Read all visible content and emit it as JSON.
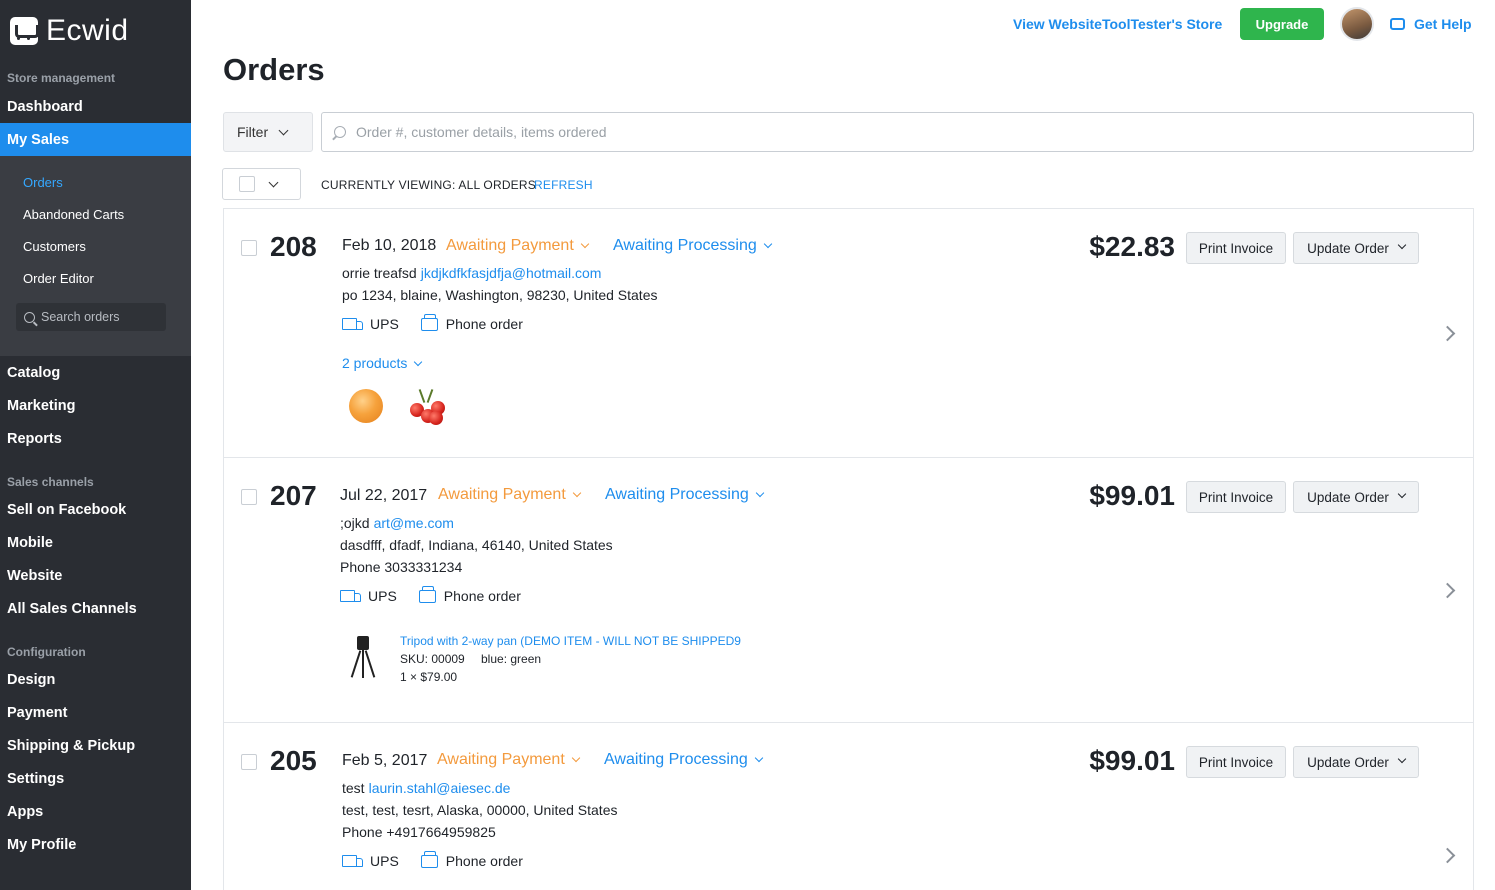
{
  "sidebar": {
    "logo_text": "Ecwid",
    "section_store": "Store management",
    "dashboard": "Dashboard",
    "my_sales": "My Sales",
    "sub_items": [
      "Orders",
      "Abandoned Carts",
      "Customers",
      "Order Editor"
    ],
    "search_placeholder": "Search orders",
    "catalog": "Catalog",
    "marketing": "Marketing",
    "reports": "Reports",
    "section_channels": "Sales channels",
    "facebook": "Sell on Facebook",
    "mobile": "Mobile",
    "website": "Website",
    "all_channels": "All Sales Channels",
    "section_config": "Configuration",
    "design": "Design",
    "payment": "Payment",
    "shipping": "Shipping & Pickup",
    "settings": "Settings",
    "apps": "Apps",
    "profile": "My Profile"
  },
  "topbar": {
    "store_link": "View WebsiteToolTester's Store",
    "upgrade": "Upgrade",
    "help": "Get Help"
  },
  "page": {
    "title": "Orders",
    "filter_label": "Filter",
    "search_placeholder": "Order #, customer details, items ordered",
    "viewing": "CURRENTLY VIEWING: ALL ORDERS",
    "refresh": "REFRESH"
  },
  "orders": [
    {
      "number": "208",
      "date": "Feb 10, 2018",
      "payment_status": "Awaiting Payment",
      "processing_status": "Awaiting Processing",
      "customer_name": "orrie treafsd",
      "email": "jkdjkdfkfasjdfja@hotmail.com",
      "address": "po 1234, blaine, Washington, 98230, United States",
      "shipping": "UPS",
      "order_type": "Phone order",
      "products_link": "2 products",
      "price": "$22.83",
      "print_invoice": "Print Invoice",
      "update_order": "Update Order"
    },
    {
      "number": "207",
      "date": "Jul 22, 2017",
      "payment_status": "Awaiting Payment",
      "processing_status": "Awaiting Processing",
      "customer_name": ";ojkd",
      "email": "art@me.com",
      "address": "dasdfff, dfadf, Indiana, 46140, United States",
      "phone": "Phone 3033331234",
      "shipping": "UPS",
      "order_type": "Phone order",
      "item_name": "Tripod with 2-way pan (DEMO ITEM - WILL NOT BE SHIPPED9",
      "item_sku": "SKU: 00009",
      "item_option": "blue: green",
      "item_qty": "1 × $79.00",
      "price": "$99.01",
      "print_invoice": "Print Invoice",
      "update_order": "Update Order"
    },
    {
      "number": "205",
      "date": "Feb 5, 2017",
      "payment_status": "Awaiting Payment",
      "processing_status": "Awaiting Processing",
      "customer_name": "test",
      "email": "laurin.stahl@aiesec.de",
      "address": "test, test, tesrt, Alaska, 00000, United States",
      "phone": "Phone +4917664959825",
      "shipping": "UPS",
      "order_type": "Phone order",
      "price": "$99.01",
      "print_invoice": "Print Invoice",
      "update_order": "Update Order"
    }
  ],
  "colors": {
    "sidebar_bg": "#2a2d33",
    "accent": "#1e8ded",
    "awaiting_payment": "#f39a3d",
    "upgrade": "#2fb54d"
  }
}
